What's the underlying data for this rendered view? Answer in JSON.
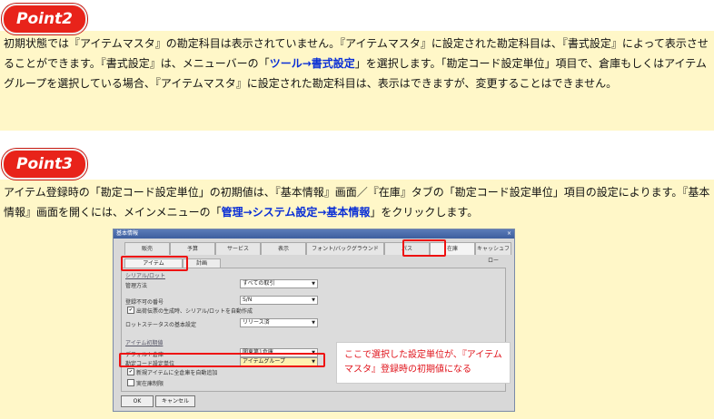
{
  "point2": {
    "badge": "Point2",
    "para": [
      {
        "t": "初期状態では『アイテムマスタ』の勘定科目は表示されていません。『アイテムマスタ』に設定された勘定科目は、『書式設定』によって表示させることができます。『書式設定』は、メニューバーの「"
      },
      {
        "t": "ツール→書式設定",
        "hl": true
      },
      {
        "t": "」を選択します。「勘定コード設定単位」項目で、倉庫もしくはアイテムグループを選択している場合、『アイテムマスタ』に設定された勘定科目は、表示はできますが、変更することはできません。"
      }
    ]
  },
  "point3": {
    "badge": "Point3",
    "para": [
      {
        "t": "アイテム登録時の「勘定コード設定単位」の初期値は、『基本情報』画面／『在庫』タブの「勘定コード設定単位」項目の設定によります。『基本情報』画面を開くには、メインメニューの「"
      },
      {
        "t": "管理→システム設定→基本情報",
        "hl": true
      },
      {
        "t": "」をクリックします。"
      }
    ]
  },
  "dialog": {
    "title": "基本情報",
    "close": "×",
    "tabs": [
      "販売",
      "予算",
      "サービス",
      "表示",
      "フォント/バックグラウンド",
      "パス",
      "在庫",
      "キャッシュフロー"
    ],
    "subtabs": [
      "アイテム",
      "計画"
    ],
    "section1": "シリアル/ロット",
    "mgmt_label": "管理方法",
    "mgmt_value": "すべての取引",
    "unique_label": "登録不可の番号",
    "unique_value": "S/N",
    "auto_create_label": "出荷伝票の生成時、シリアル/ロットを自動作成",
    "lot_status_label": "ロットステータスの基本設定",
    "lot_status_value": "リリース済",
    "section2": "アイテム初期値",
    "default_wh_label": "デフォルト倉庫",
    "default_wh_value": "関東第1倉庫",
    "acct_label": "勘定コード設定単位",
    "acct_value": "アイテムグループ",
    "auto_add_label": "新規アイテムに全倉庫を自動追加",
    "negative_label": "実在庫制限",
    "ok": "OK",
    "cancel": "キャンセル"
  },
  "callout": "ここで選択した設定単位が、『アイテムマスタ』登録時の初期値になる"
}
